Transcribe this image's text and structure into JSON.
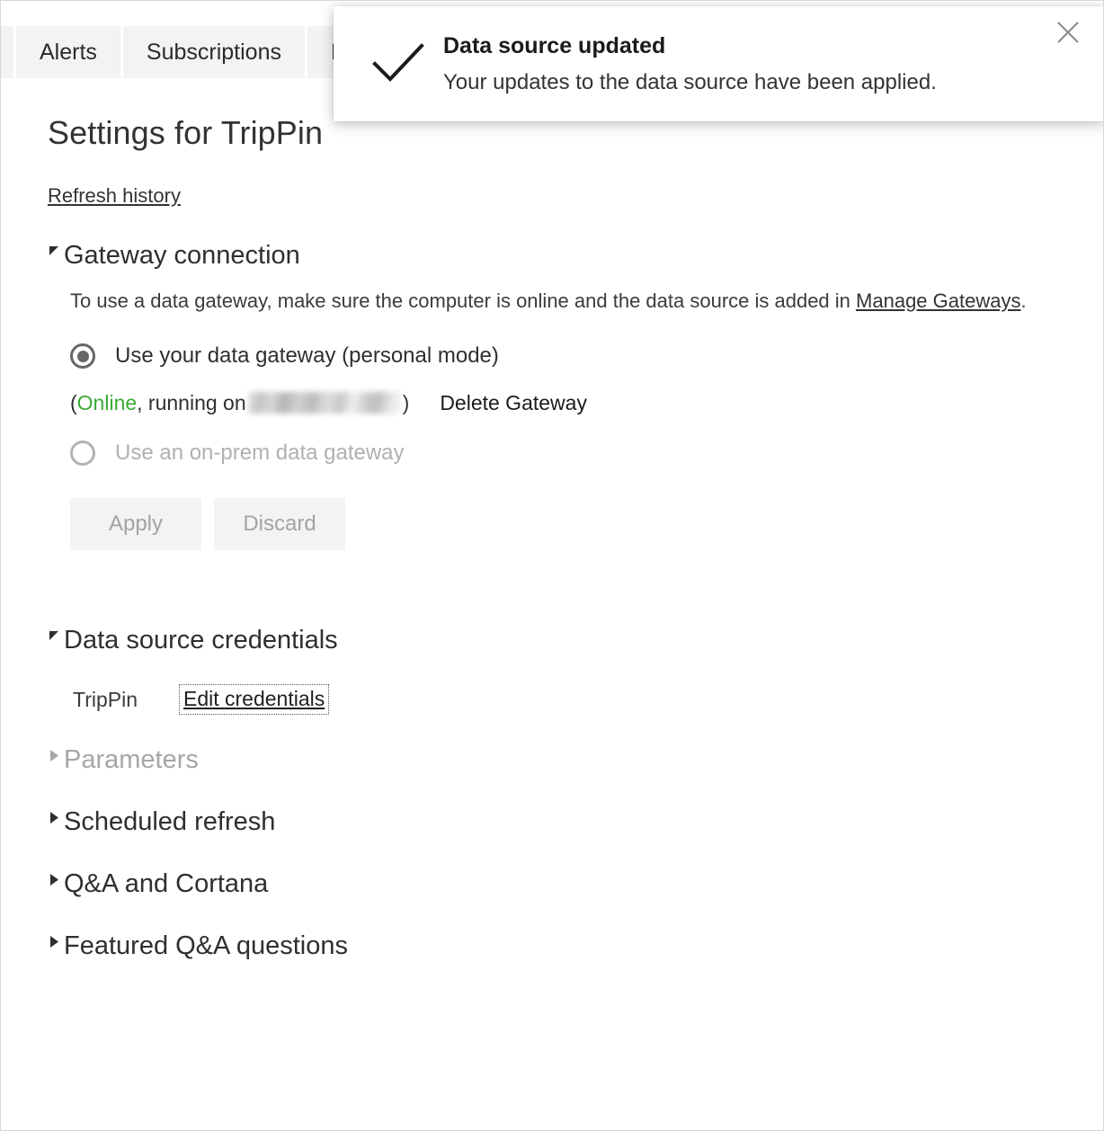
{
  "tabs": [
    {
      "label": "",
      "clipped_left": true
    },
    {
      "label": "Alerts"
    },
    {
      "label": "Subscriptions"
    },
    {
      "label": "D",
      "clipped_right": true
    }
  ],
  "page": {
    "title": "Settings for TripPin",
    "refresh_history_link": "Refresh history"
  },
  "gateway": {
    "section_title": "Gateway connection",
    "expanded": true,
    "description_before_link": "To use a data gateway, make sure the computer is online and the data source is added in ",
    "description_link": "Manage Gateways",
    "description_after_link": ".",
    "options": [
      {
        "label": "Use your data gateway (personal mode)",
        "selected": true,
        "disabled": false
      },
      {
        "label": "Use an on-prem data gateway",
        "selected": false,
        "disabled": true
      }
    ],
    "status": {
      "open_paren": "(",
      "state": "Online",
      "state_color": "#3aaa35",
      "running_on": ", running on ",
      "host_redacted": true,
      "close_paren": ")"
    },
    "delete_gateway_label": "Delete Gateway",
    "buttons": {
      "apply_label": "Apply",
      "discard_label": "Discard",
      "disabled": true
    }
  },
  "credentials": {
    "section_title": "Data source credentials",
    "expanded": true,
    "rows": [
      {
        "name": "TripPin",
        "action_label": "Edit credentials",
        "focused": true
      }
    ]
  },
  "collapsed_sections": [
    {
      "label": "Parameters",
      "disabled": true
    },
    {
      "label": "Scheduled refresh",
      "disabled": false
    },
    {
      "label": "Q&A and Cortana",
      "disabled": false
    },
    {
      "label": "Featured Q&A questions",
      "disabled": false
    }
  ],
  "toast": {
    "icon": "checkmark-icon",
    "title": "Data source updated",
    "message": "Your updates to the data source have been applied.",
    "close_icon": "close-icon"
  },
  "colors": {
    "tab_background": "#f3f3f3",
    "text": "#333333",
    "disabled_text": "#a6a6a6",
    "online_green": "#3aaa35"
  }
}
